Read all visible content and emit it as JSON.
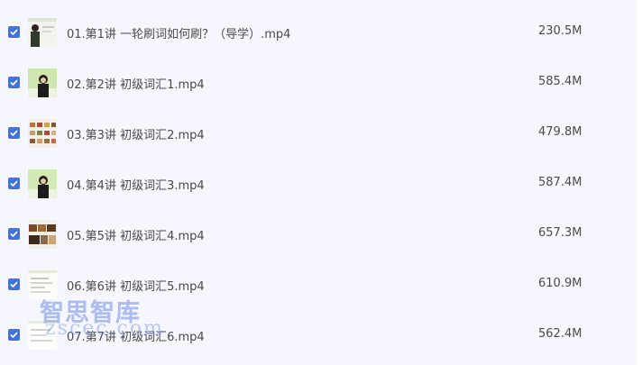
{
  "files": [
    {
      "name": "01.第1讲 一轮刷词如何刷？（导学）.mp4",
      "size": "230.5M",
      "checked": true,
      "thumb": "thumb-teacher-white"
    },
    {
      "name": "02.第2讲 初级词汇1.mp4",
      "size": "585.4M",
      "checked": true,
      "thumb": "thumb-teacher-green"
    },
    {
      "name": "03.第3讲 初级词汇2.mp4",
      "size": "479.8M",
      "checked": true,
      "thumb": "thumb-food-grid"
    },
    {
      "name": "04.第4讲 初级词汇3.mp4",
      "size": "587.4M",
      "checked": true,
      "thumb": "thumb-teacher-green"
    },
    {
      "name": "05.第5讲 初级词汇4.mp4",
      "size": "657.3M",
      "checked": true,
      "thumb": "thumb-photos"
    },
    {
      "name": "06.第6讲 初级词汇5.mp4",
      "size": "610.9M",
      "checked": true,
      "thumb": "thumb-slide"
    },
    {
      "name": "07.第7讲 初级词汇6.mp4",
      "size": "562.4M",
      "checked": true,
      "thumb": "thumb-slide-white"
    }
  ],
  "watermark": {
    "cn": "智思智库",
    "en": "zscec.com"
  },
  "colors": {
    "accent": "#3b74e6",
    "panel": "#f6f7fe",
    "text": "#4a4a4a"
  }
}
